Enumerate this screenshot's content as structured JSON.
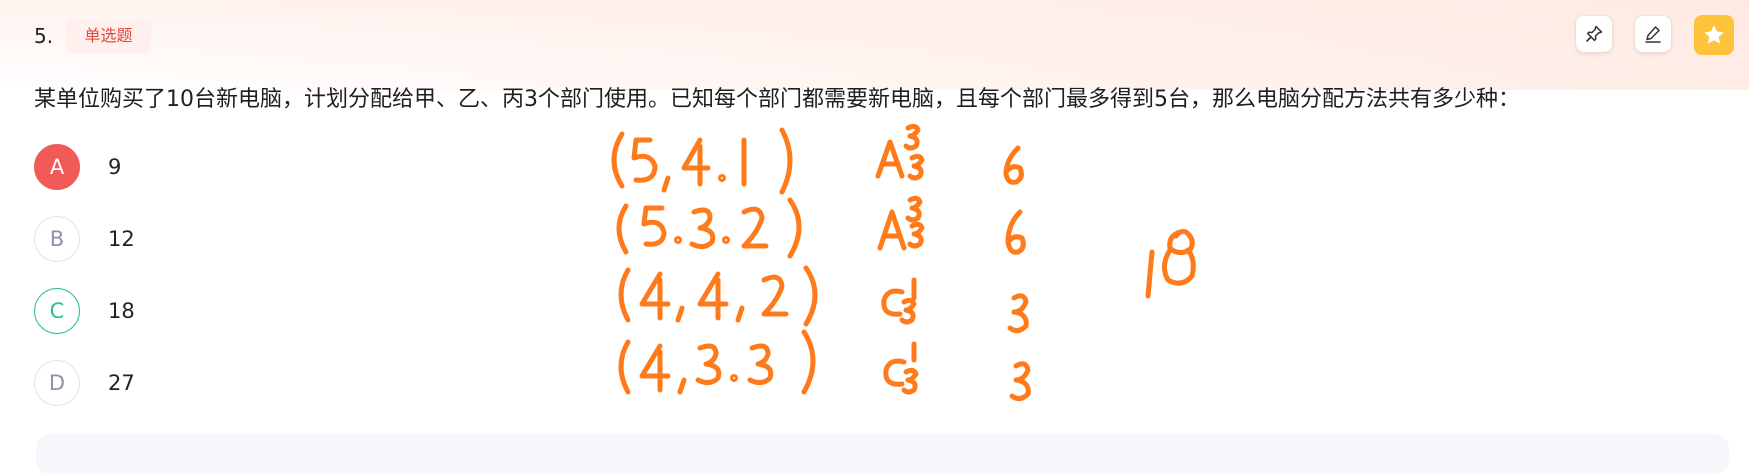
{
  "question": {
    "number": "5.",
    "type_badge": "单选题",
    "text": "某单位购买了10台新电脑，计划分配给甲、乙、丙3个部门使用。已知每个部门都需要新电脑，且每个部门最多得到5台，那么电脑分配方法共有多少种："
  },
  "toolbar": {
    "icons": [
      "pin-icon",
      "edit-icon",
      "star-icon"
    ],
    "star_color": "#ffc23b"
  },
  "options": [
    {
      "letter": "A",
      "text": "9",
      "state": "selected-wrong"
    },
    {
      "letter": "B",
      "text": "12",
      "state": "normal"
    },
    {
      "letter": "C",
      "text": "18",
      "state": "correct"
    },
    {
      "letter": "D",
      "text": "27",
      "state": "normal"
    }
  ],
  "colors": {
    "wrong": "#f25a58",
    "correct": "#2ebf8f",
    "badge_text": "#e2483d",
    "ink": "#ff7a1a"
  },
  "handwritten_notes": {
    "rows": [
      {
        "tuple": "(5,4.1)",
        "method": "A₃³",
        "count": "6"
      },
      {
        "tuple": "(5.3.2)",
        "method": "A₃³",
        "count": "6"
      },
      {
        "tuple": "(4,4,2)",
        "method": "C₃¹",
        "count": "3"
      },
      {
        "tuple": "(4,3.3)",
        "method": "C₃¹",
        "count": "3"
      }
    ],
    "total": "18"
  }
}
